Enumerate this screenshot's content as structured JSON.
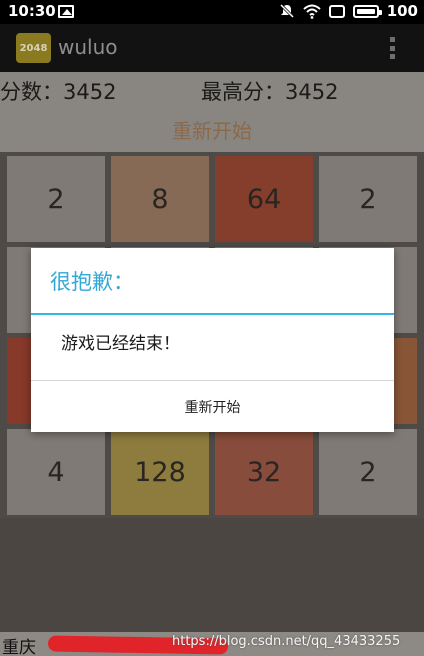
{
  "status_bar": {
    "time": "10:30",
    "battery": "100",
    "icons": [
      "image-icon",
      "mute-icon",
      "wifi-icon",
      "screen-icon",
      "battery-icon"
    ]
  },
  "app": {
    "logo_text": "2048",
    "title": "wuluo"
  },
  "scores": {
    "score_label": "分数：3452",
    "best_label": "最高分：3452"
  },
  "restart_label": "重新开始",
  "board": {
    "rows": [
      [
        {
          "value": "2",
          "color": "#7f7a75"
        },
        {
          "value": "8",
          "color": "#876a55"
        },
        {
          "value": "64",
          "color": "#853d2c"
        },
        {
          "value": "2",
          "color": "#7f7a75"
        }
      ],
      [
        {
          "value": "",
          "color": "#7f7a75"
        },
        {
          "value": "",
          "color": "#7f7a75"
        },
        {
          "value": "",
          "color": "#7f7a75"
        },
        {
          "value": "",
          "color": "#7f7a75"
        }
      ],
      [
        {
          "value": "",
          "color": "#87392a"
        },
        {
          "value": "",
          "color": "#7f7a75"
        },
        {
          "value": "",
          "color": "#7f7a75"
        },
        {
          "value": "",
          "color": "#885636"
        }
      ],
      [
        {
          "value": "4",
          "color": "#7f7a75"
        },
        {
          "value": "128",
          "color": "#8e7b3e"
        },
        {
          "value": "32",
          "color": "#884c3c"
        },
        {
          "value": "2",
          "color": "#7f7a75"
        }
      ]
    ]
  },
  "dialog": {
    "title": "很抱歉：",
    "message": "游戏已经结束！",
    "button": "重新开始",
    "accent_color": "#33b5e5"
  },
  "footer": {
    "text": "重庆",
    "watermark": "https://blog.csdn.net/qq_43433255"
  }
}
